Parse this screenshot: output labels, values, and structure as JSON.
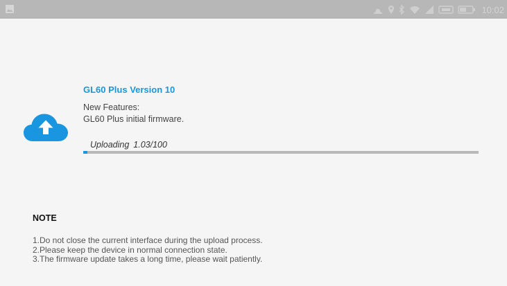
{
  "status_bar": {
    "time": "10:02",
    "icons": [
      "image-icon",
      "usb-icon",
      "location-icon",
      "bluetooth-icon",
      "wifi-icon",
      "signal-icon",
      "sim-icon",
      "battery-icon"
    ]
  },
  "update": {
    "version_title": "GL60 Plus Version 10",
    "features_label": "New Features:",
    "features_text": "GL60 Plus initial firmware.",
    "status_label": "Uploading",
    "progress_text": "1.03/100",
    "progress_percent": 1.03,
    "accent_color": "#1a96e0"
  },
  "note": {
    "title": "NOTE",
    "items": [
      "1.Do not close the current interface during the upload process.",
      "2.Please keep the device in normal connection state.",
      "3.The firmware update takes a long time, please wait patiently."
    ]
  }
}
